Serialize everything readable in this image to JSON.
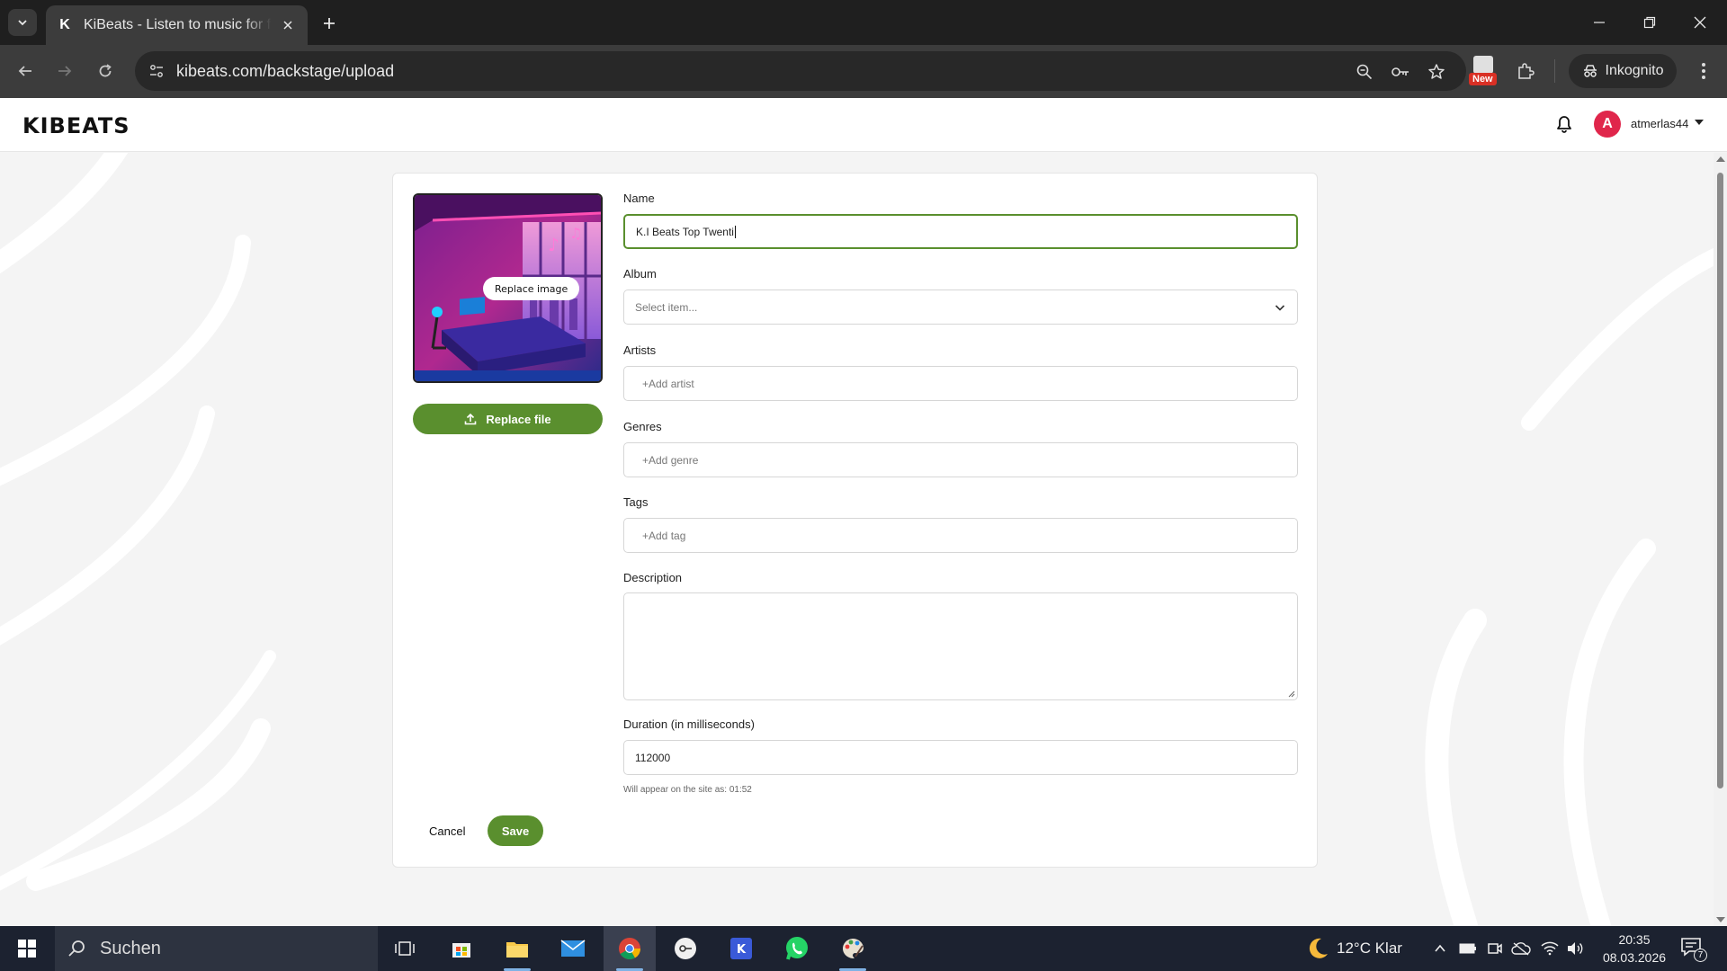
{
  "browser": {
    "tab_title": "KiBeats - Listen to music for free",
    "url": "kibeats.com/backstage/upload",
    "new_badge": "New",
    "incognito_label": "Inkognito"
  },
  "header": {
    "logo": "KIBEATS",
    "avatar_initial": "A",
    "username": "atmerlas44"
  },
  "form": {
    "replace_image_label": "Replace image",
    "replace_file_label": "Replace file",
    "name_label": "Name",
    "name_value": "K.I Beats Top Twenti",
    "album_label": "Album",
    "album_placeholder": "Select item...",
    "artists_label": "Artists",
    "artists_placeholder": "+Add artist",
    "genres_label": "Genres",
    "genres_placeholder": "+Add genre",
    "tags_label": "Tags",
    "tags_placeholder": "+Add tag",
    "description_label": "Description",
    "description_value": "",
    "duration_label": "Duration (in milliseconds)",
    "duration_value": "112000",
    "duration_hint": "Will appear on the site as: 01:52",
    "cancel_label": "Cancel",
    "save_label": "Save"
  },
  "colors": {
    "accent": "#5a8f2e",
    "avatar": "#e0264b"
  },
  "taskbar": {
    "search_label": "Suchen",
    "weather": "12°C  Klar",
    "time": "20:35",
    "date": "08.03.2026",
    "notification_count": "7"
  }
}
